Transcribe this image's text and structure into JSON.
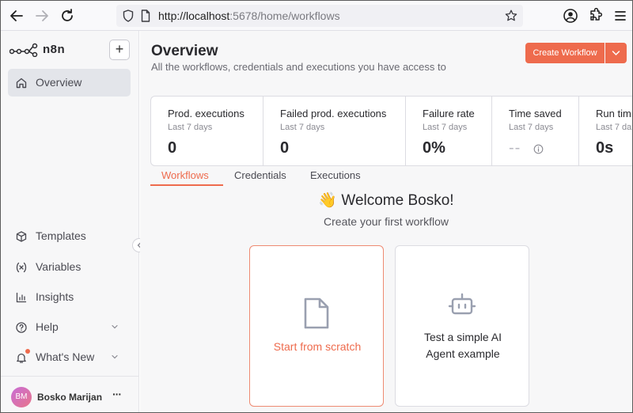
{
  "browser": {
    "url_host": "http://localhost",
    "url_rest": ":5678/home/workflows"
  },
  "sidebar": {
    "brand": "n8n",
    "add_label": "+",
    "top_items": [
      {
        "label": "Overview",
        "icon": "home-icon",
        "active": true
      }
    ],
    "bottom_items": [
      {
        "label": "Templates",
        "icon": "box-icon"
      },
      {
        "label": "Variables",
        "icon": "variable-icon"
      },
      {
        "label": "Insights",
        "icon": "chart-icon"
      },
      {
        "label": "Help",
        "icon": "help-icon",
        "chevron": true
      },
      {
        "label": "What's New",
        "icon": "bell-icon",
        "chevron": true,
        "badge": true
      }
    ],
    "user": {
      "initials": "BM",
      "name": "Bosko Marijan",
      "menu": "···"
    }
  },
  "header": {
    "title": "Overview",
    "subtitle": "All the workflows, credentials and executions you have access to",
    "create_label": "Create Workflow"
  },
  "stats": [
    {
      "label": "Prod. executions",
      "sub": "Last 7 days",
      "value": "0"
    },
    {
      "label": "Failed prod. executions",
      "sub": "Last 7 days",
      "value": "0"
    },
    {
      "label": "Failure rate",
      "sub": "Last 7 days",
      "value": "0%"
    },
    {
      "label": "Time saved",
      "sub": "Last 7 days",
      "value": "--"
    },
    {
      "label": "Run tim",
      "sub": "Last 7 da",
      "value": "0s"
    }
  ],
  "tabs": [
    {
      "label": "Workflows",
      "active": true
    },
    {
      "label": "Credentials",
      "active": false
    },
    {
      "label": "Executions",
      "active": false
    }
  ],
  "welcome": {
    "title": "👋 Welcome Bosko!",
    "subtitle": "Create your first workflow"
  },
  "cards": {
    "scratch_label": "Start from scratch",
    "ai_label_line1": "Test a simple AI",
    "ai_label_line2": "Agent example"
  },
  "colors": {
    "accent": "#ee6b4d",
    "sidebar_bg": "#f7f7f8"
  }
}
